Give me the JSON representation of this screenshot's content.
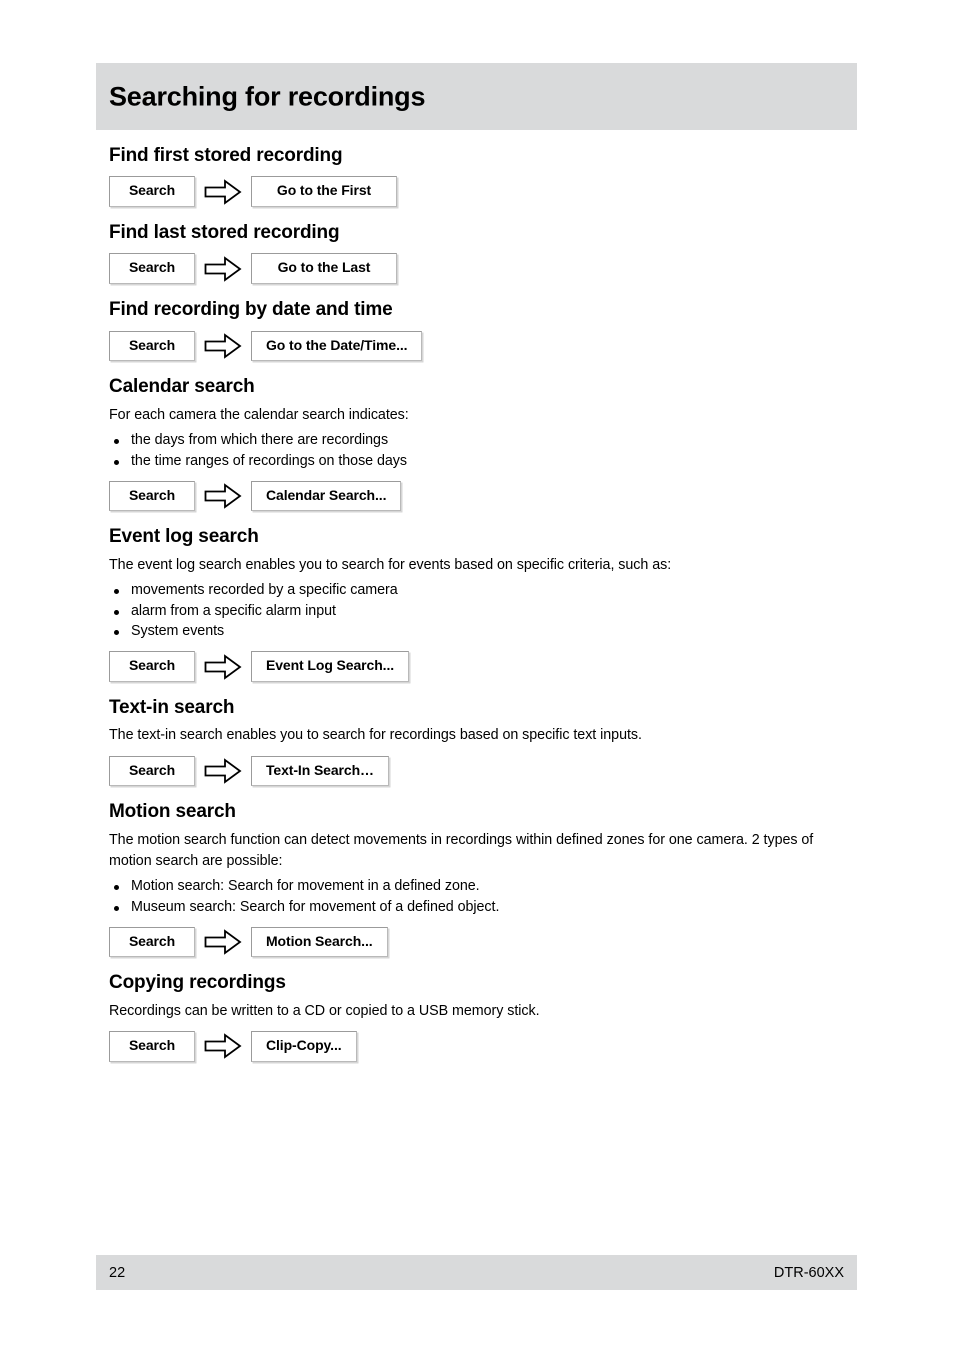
{
  "page": {
    "title": "Searching for recordings",
    "footer": {
      "page_number": "22",
      "model": "DTR-60XX"
    }
  },
  "icons": {
    "arrow": "right-block-arrow-icon",
    "bullet": "bullet-dot-icon"
  },
  "sections": [
    {
      "heading": "Find first stored recording",
      "intro": null,
      "bullets": [],
      "menu_path": {
        "first_label": "Search",
        "second_label": "Go to the First"
      }
    },
    {
      "heading": "Find last stored recording",
      "intro": null,
      "bullets": [],
      "menu_path": {
        "first_label": "Search",
        "second_label": "Go to the Last"
      }
    },
    {
      "heading": "Find recording by date and time",
      "intro": null,
      "bullets": [],
      "menu_path": {
        "first_label": "Search",
        "second_label": "Go to the Date/Time..."
      }
    },
    {
      "heading": "Calendar search",
      "intro": "For each camera the calendar search indicates:",
      "bullets": [
        "the days from which there are recordings",
        "the time ranges of recordings on those days"
      ],
      "menu_path": {
        "first_label": "Search",
        "second_label": "Calendar Search..."
      }
    },
    {
      "heading": "Event log search",
      "intro": "The event log search enables you to search for events based on specific criteria, such as:",
      "bullets": [
        "movements recorded by a specific camera",
        "alarm from a specific alarm input",
        "System events"
      ],
      "menu_path": {
        "first_label": "Search",
        "second_label": "Event Log Search..."
      }
    },
    {
      "heading": "Text-in search",
      "intro": "The text-in search enables you to search for recordings based on specific text inputs.",
      "bullets": [],
      "menu_path": {
        "first_label": "Search",
        "second_label": "Text-In Search…"
      }
    },
    {
      "heading": "Motion search",
      "intro": "The motion search function can detect movements in recordings within defined zones for one camera. 2 types of motion search are possible:",
      "bullets": [
        "Motion search: Search for movement in a defined zone.",
        "Museum search: Search for movement of a defined object."
      ],
      "menu_path": {
        "first_label": "Search",
        "second_label": "Motion Search..."
      }
    },
    {
      "heading": "Copying recordings",
      "intro": "Recordings can be written to a CD or copied to a USB memory stick.",
      "bullets": [],
      "menu_path": {
        "first_label": "Search",
        "second_label": "Clip-Copy..."
      }
    }
  ],
  "colors": {
    "banner_gray": "#d9dadb",
    "text": "#000000",
    "button_border": "#9b9b9b",
    "button_shadow": "#d6d6d6"
  }
}
